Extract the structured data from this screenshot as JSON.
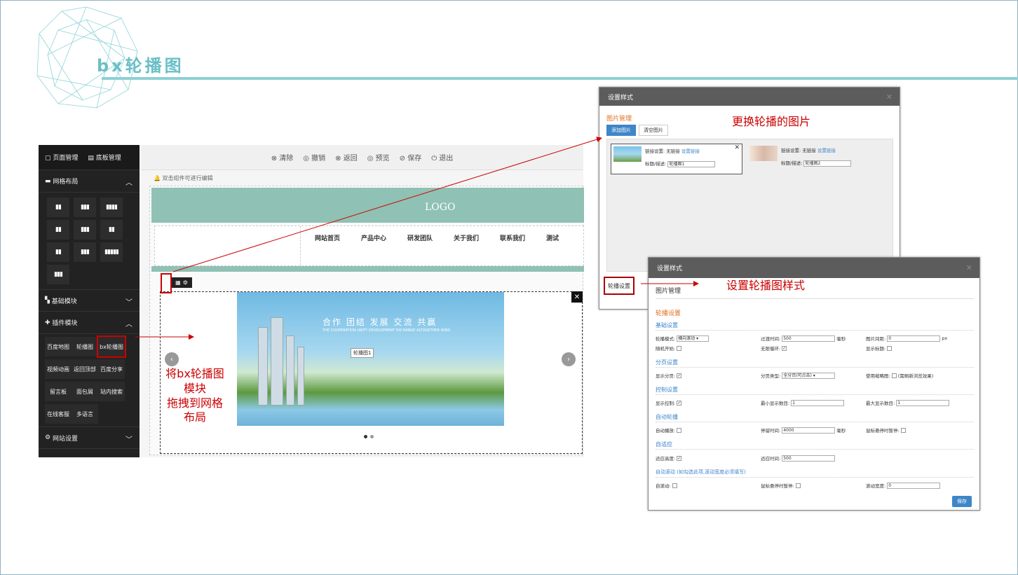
{
  "slide": {
    "title": "bx轮播图"
  },
  "editor": {
    "top_tabs": [
      "页面管理",
      "底板管理"
    ],
    "sections": {
      "grid_layout": "网格布局",
      "basic_modules": "基础模块",
      "plugin_modules": "插件模块",
      "site_settings": "网站设置"
    },
    "grid_buttons": [
      "▮▮",
      "▮▮▮",
      "▮▮▮▮",
      "▮▮",
      "▮▮▮",
      "▮▮",
      "▮▮",
      "▮▮▮",
      "▮▮▮▮▮",
      "▮▮▮"
    ],
    "plugins": [
      "百度地图",
      "轮播图",
      "bx轮播图",
      "视频动画",
      "返回顶部",
      "百度分享",
      "留言板",
      "面包屑",
      "站内搜索",
      "在线客服",
      "多语言"
    ],
    "toolbar": [
      "⊗ 清除",
      "◎ 撤销",
      "⊗ 返回",
      "◎ 预览",
      "⊘ 保存",
      "⏻ 退出"
    ],
    "hint": "双击组件可进行编辑",
    "logo": "LOGO",
    "nav": [
      "网站首页",
      "产品中心",
      "研发团队",
      "关于我们",
      "联系我们",
      "测试"
    ],
    "slider": {
      "headline": "合作  团结  发展  交流  共赢",
      "subline": "THE COOPERATION UNITY DEVELOPMENT EXCHANGE ALTOGETHER WINS",
      "label": "轮播图1"
    }
  },
  "annotations": {
    "drag": "将bx轮播图\n模块\n拖拽到网格\n布局",
    "change_images": "更换轮播的图片",
    "set_style": "设置轮播图样式"
  },
  "dialog1": {
    "title": "设置样式",
    "section": "图片管理",
    "add_btn": "添加图片",
    "clear_btn": "清空图片",
    "cards": [
      {
        "link_label": "链接设置: 无链接",
        "link_action": "设置链接",
        "desc_label": "标题/描述:",
        "desc_value": "轮播图1"
      },
      {
        "link_label": "链接设置: 无链接",
        "link_action": "设置链接",
        "desc_label": "标题/描述:",
        "desc_value": "轮播图2"
      }
    ],
    "tab": "轮播设置"
  },
  "dialog2": {
    "title": "设置样式",
    "tab": "图片管理",
    "main_section": "轮播设置",
    "groups": {
      "basic": "基础设置",
      "paging": "分页设置",
      "control": "控制设置",
      "auto": "自动轮播",
      "adaptive": "自适应",
      "autoscroll": "自动滚动 (如勾选此项,滚动宽度必须填写)"
    },
    "fields": {
      "mode_label": "轮播模式:",
      "mode_value": "横向滚动",
      "transition_label": "过渡时间:",
      "transition_value": "500",
      "ms": "毫秒",
      "gap_label": "图片间距:",
      "gap_value": "0",
      "px": "px",
      "random_label": "随机开始:",
      "loop_label": "无限循环:",
      "showtitle_label": "显示标题:",
      "pager_label": "显示分页:",
      "pagertype_label": "分页类型:",
      "pagertype_value": "全分页(可点击)",
      "thumb_label": "使用缩略图:",
      "thumb_note": "(需刷新浏览效果)",
      "controls_label": "显示控制:",
      "min_label": "最小显示数目:",
      "min_value": "1",
      "max_label": "最大显示数目:",
      "max_value": "1",
      "autoplay_label": "自动播放:",
      "pause_label": "停留时间:",
      "pause_value": "4000",
      "ms2": "毫秒",
      "hoverpause_label": "鼠标悬停时暂停:",
      "adaptheight_label": "适应高度:",
      "adapttime_label": "适应时间:",
      "adapttime_value": "500",
      "autoscroll_label": "自滚动:",
      "hoverpause2_label": "鼠标悬停时暂停:",
      "scrollwidth_label": "滚动宽度:",
      "scrollwidth_value": "0"
    },
    "save": "保存"
  }
}
